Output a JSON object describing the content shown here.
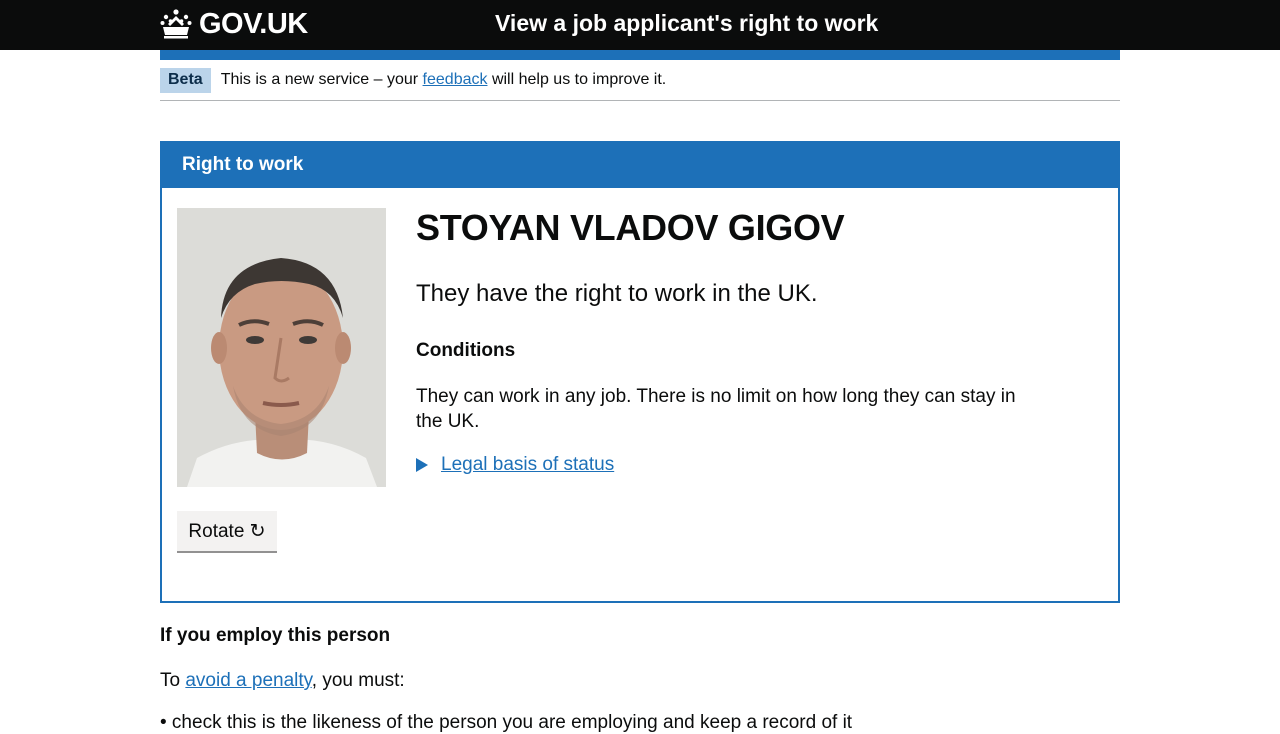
{
  "header": {
    "logo_text": "GOV.UK",
    "service_name": "View a job applicant's right to work"
  },
  "phase_banner": {
    "tag": "Beta",
    "text_before": "This is a new service – your",
    "link": "feedback",
    "text_after": "will help us to improve it."
  },
  "panel": {
    "heading": "Right to work",
    "rotate_label": "Rotate ↻",
    "person_name": "STOYAN VLADOV GIGOV",
    "status": "They have the right to work in the UK.",
    "conditions_heading": "Conditions",
    "conditions_text": "They can work in any job. There is no limit on how long they can stay in the UK.",
    "details_label": "Legal basis of status"
  },
  "employ": {
    "heading": "If you employ this person",
    "text_before": "To",
    "link": "avoid a penalty",
    "text_after": ", you must:",
    "cut_item": "• check this is the likeness of the person you are employing and keep a record of it"
  },
  "colors": {
    "header_bg": "#0b0c0c",
    "brand_blue": "#1d70b8",
    "phase_tag_bg": "#bbd4ea",
    "button_bg": "#f3f2f1"
  }
}
